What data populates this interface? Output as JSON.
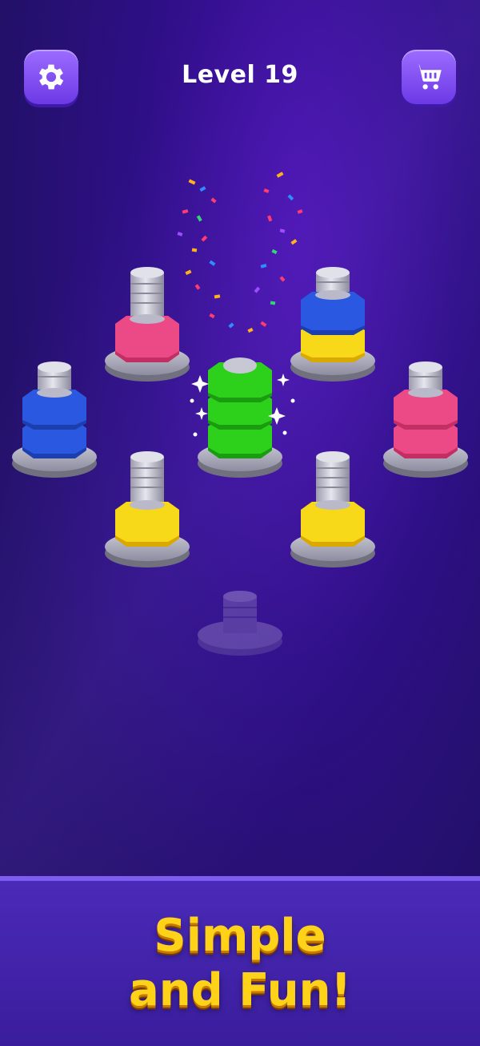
{
  "header": {
    "level_label": "Level 19",
    "settings_icon": "gear-icon",
    "cart_icon": "cart-icon"
  },
  "colors": {
    "red": "#ec4a86",
    "blue": "#2a58e0",
    "yellow": "#f7d91a",
    "green": "#2dd11b",
    "button": "#7b47f0",
    "tagline": "#ffd21a"
  },
  "poles": [
    {
      "id": "pole-1",
      "nuts": [
        "red"
      ]
    },
    {
      "id": "pole-2",
      "nuts": [
        "yellow",
        "blue"
      ]
    },
    {
      "id": "pole-3",
      "nuts": [
        "blue",
        "blue"
      ]
    },
    {
      "id": "pole-4",
      "nuts": [
        "green",
        "green",
        "green"
      ],
      "completed": true
    },
    {
      "id": "pole-5",
      "nuts": [
        "red",
        "red"
      ]
    },
    {
      "id": "pole-6",
      "nuts": [
        "yellow"
      ]
    },
    {
      "id": "pole-7",
      "nuts": [
        "yellow"
      ]
    },
    {
      "id": "pole-8",
      "nuts": [],
      "locked": true
    }
  ],
  "promo": {
    "line1": "Simple",
    "line2": "and Fun!"
  }
}
